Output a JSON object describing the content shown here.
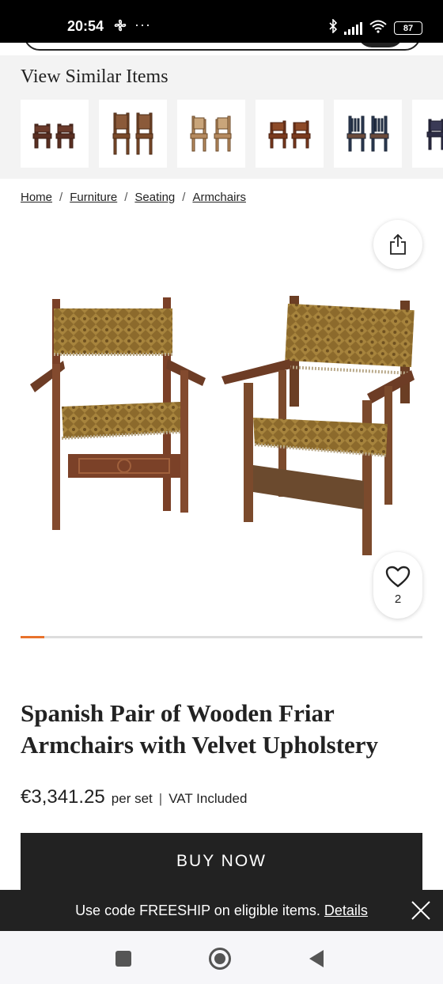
{
  "status_bar": {
    "time": "20:54",
    "more": "···",
    "battery": "87",
    "icons": [
      "fan-icon",
      "bluetooth-icon",
      "signal-icon",
      "wifi-icon",
      "battery-icon"
    ]
  },
  "similar_items": {
    "title": "View Similar Items",
    "thumbnails": [
      "thumbnail-1",
      "thumbnail-2",
      "thumbnail-3",
      "thumbnail-4",
      "thumbnail-5",
      "thumbnail-6"
    ]
  },
  "breadcrumb": {
    "items": [
      {
        "label": "Home"
      },
      {
        "label": "Furniture"
      },
      {
        "label": "Seating"
      },
      {
        "label": "Armchairs"
      }
    ],
    "separator": "/"
  },
  "gallery": {
    "favorite_count": "2",
    "progress": 0.06
  },
  "product": {
    "title": "Spanish Pair of Wooden Friar Armchairs with Velvet Upholstery",
    "price": "€3,341.25",
    "per_set": "per set",
    "separator": "|",
    "vat": "VAT Included",
    "buy_label": "BUY NOW"
  },
  "promo": {
    "text": "Use code FREESHIP on eligible items.",
    "link": "Details"
  },
  "colors": {
    "accent": "#e8722c",
    "dark": "#222222",
    "band": "#f3f3f3"
  }
}
